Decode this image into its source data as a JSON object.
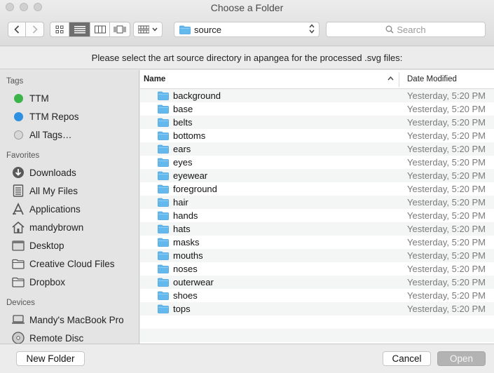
{
  "window": {
    "title": "Choose a Folder"
  },
  "toolbar": {
    "path_label": "source",
    "search_placeholder": "Search"
  },
  "message": "Please select the art source directory in apangea for the processed .svg files:",
  "sidebar": {
    "tags_title": "Tags",
    "tags": [
      {
        "label": "TTM",
        "color": "#3db44a"
      },
      {
        "label": "TTM Repos",
        "color": "#2f8fe0"
      },
      {
        "label": "All Tags…",
        "color": "#c8c8c8"
      }
    ],
    "favorites_title": "Favorites",
    "favorites": [
      {
        "label": "Downloads",
        "icon": "downloads-icon"
      },
      {
        "label": "All My Files",
        "icon": "all-my-files-icon"
      },
      {
        "label": "Applications",
        "icon": "applications-icon"
      },
      {
        "label": "mandybrown",
        "icon": "home-icon"
      },
      {
        "label": "Desktop",
        "icon": "desktop-icon"
      },
      {
        "label": "Creative Cloud Files",
        "icon": "folder-icon"
      },
      {
        "label": "Dropbox",
        "icon": "folder-icon"
      }
    ],
    "devices_title": "Devices",
    "devices": [
      {
        "label": "Mandy's MacBook Pro",
        "icon": "laptop-icon"
      },
      {
        "label": "Remote Disc",
        "icon": "disc-icon"
      }
    ]
  },
  "list": {
    "col_name": "Name",
    "col_date": "Date Modified",
    "rows": [
      {
        "name": "background",
        "date": "Yesterday, 5:20 PM"
      },
      {
        "name": "base",
        "date": "Yesterday, 5:20 PM"
      },
      {
        "name": "belts",
        "date": "Yesterday, 5:20 PM"
      },
      {
        "name": "bottoms",
        "date": "Yesterday, 5:20 PM"
      },
      {
        "name": "ears",
        "date": "Yesterday, 5:20 PM"
      },
      {
        "name": "eyes",
        "date": "Yesterday, 5:20 PM"
      },
      {
        "name": "eyewear",
        "date": "Yesterday, 5:20 PM"
      },
      {
        "name": "foreground",
        "date": "Yesterday, 5:20 PM"
      },
      {
        "name": "hair",
        "date": "Yesterday, 5:20 PM"
      },
      {
        "name": "hands",
        "date": "Yesterday, 5:20 PM"
      },
      {
        "name": "hats",
        "date": "Yesterday, 5:20 PM"
      },
      {
        "name": "masks",
        "date": "Yesterday, 5:20 PM"
      },
      {
        "name": "mouths",
        "date": "Yesterday, 5:20 PM"
      },
      {
        "name": "noses",
        "date": "Yesterday, 5:20 PM"
      },
      {
        "name": "outerwear",
        "date": "Yesterday, 5:20 PM"
      },
      {
        "name": "shoes",
        "date": "Yesterday, 5:20 PM"
      },
      {
        "name": "tops",
        "date": "Yesterday, 5:20 PM"
      }
    ]
  },
  "buttons": {
    "new_folder": "New Folder",
    "cancel": "Cancel",
    "open": "Open"
  },
  "colors": {
    "folder": "#63b8ee",
    "accent_active": "#6e6e6e"
  }
}
